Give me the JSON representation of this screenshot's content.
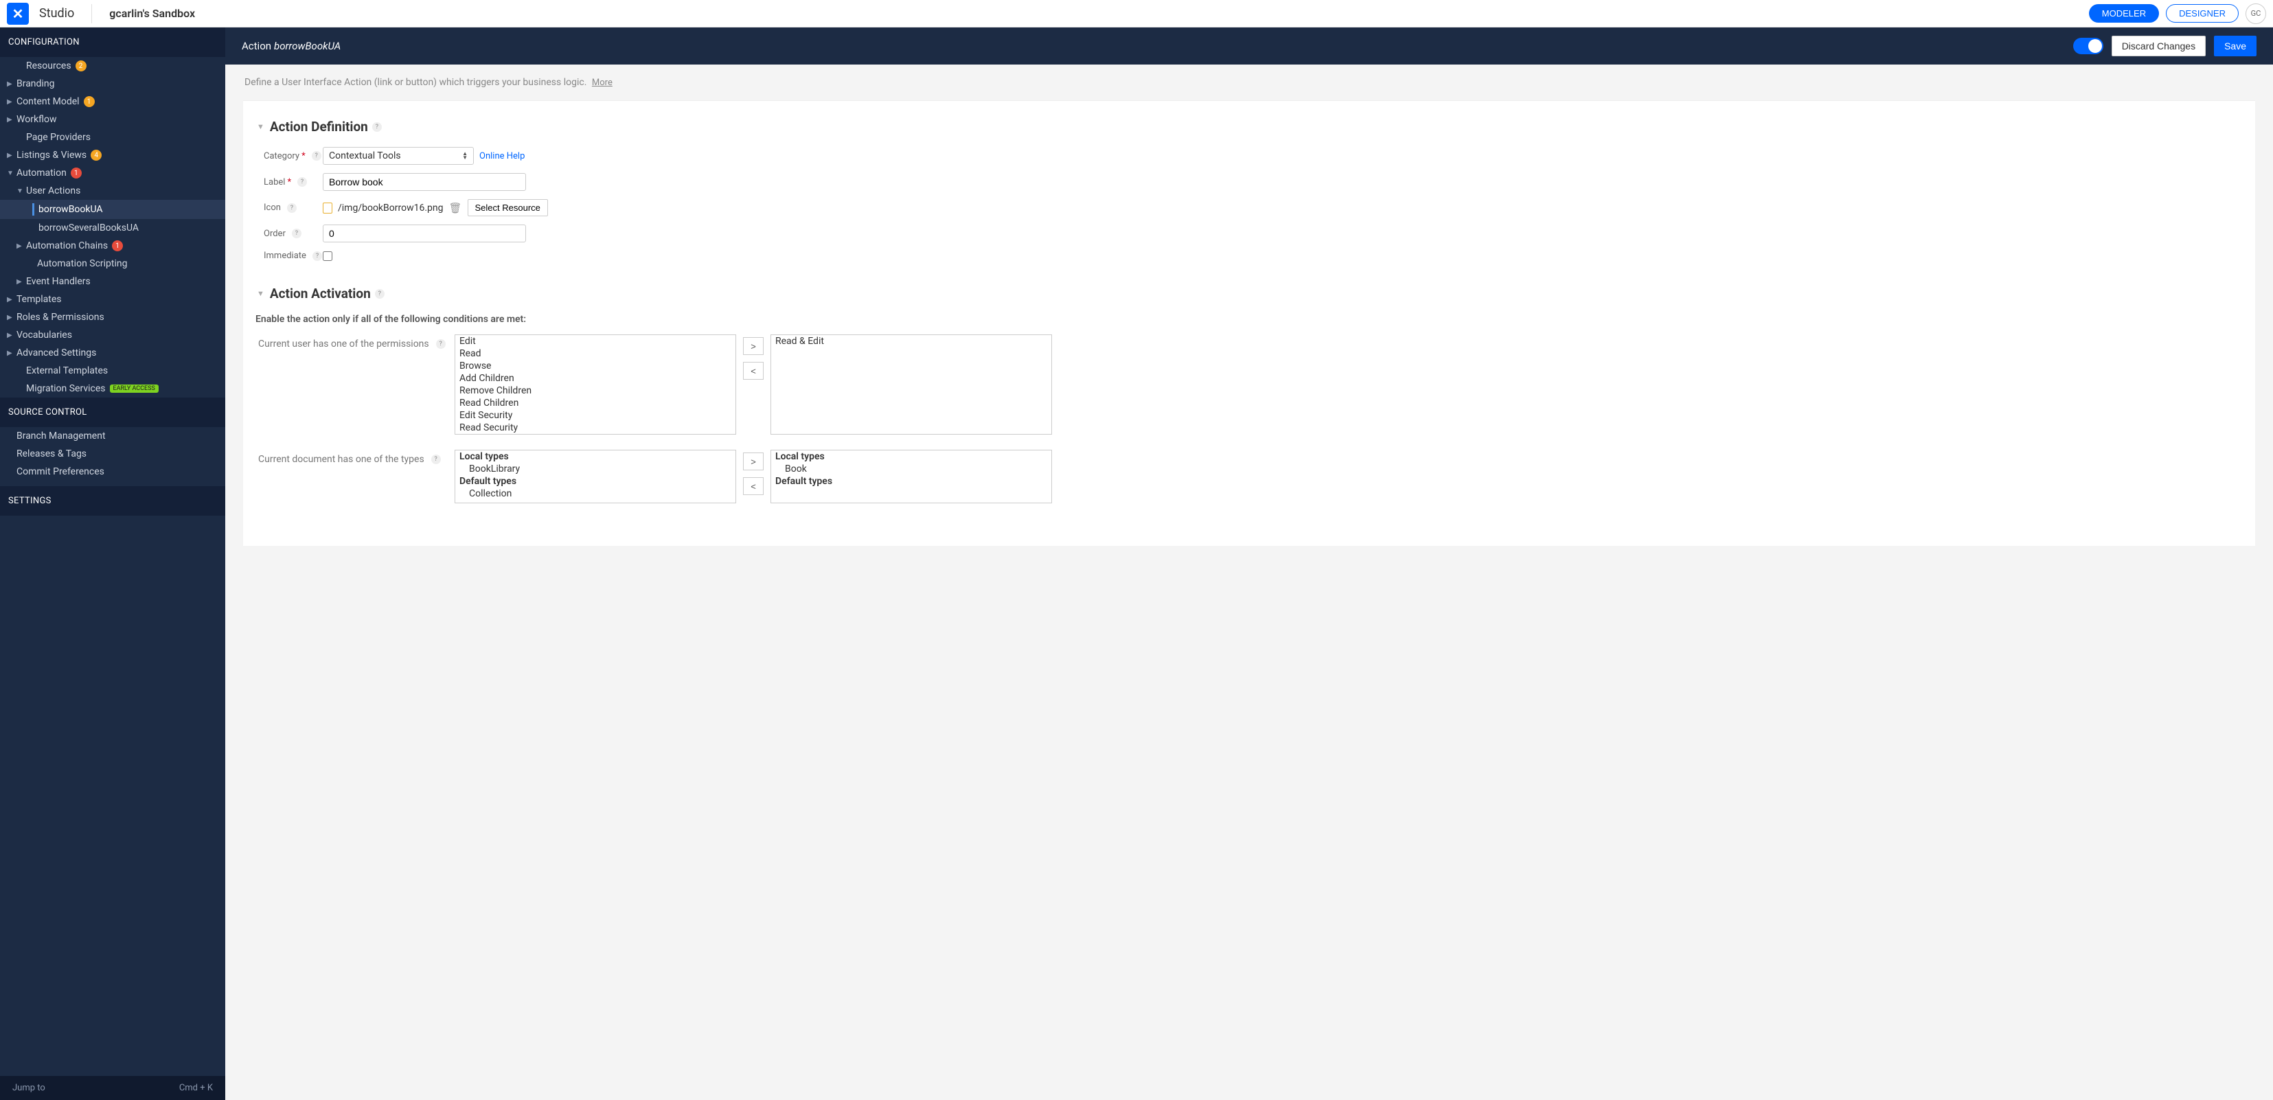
{
  "app": {
    "title": "Studio",
    "project": "gcarlin's Sandbox"
  },
  "header_buttons": {
    "modeler": "MODELER",
    "designer": "DESIGNER",
    "user_initials": "GC"
  },
  "action_bar": {
    "prefix": "Action",
    "name": "borrowBookUA",
    "discard": "Discard Changes",
    "save": "Save"
  },
  "description": {
    "text": "Define a User Interface Action (link or button) which triggers your business logic.",
    "more": "More"
  },
  "sidebar": {
    "sections": {
      "configuration": "CONFIGURATION",
      "source_control": "SOURCE CONTROL",
      "settings": "SETTINGS"
    },
    "items": {
      "resources": "Resources",
      "resources_badge": "2",
      "branding": "Branding",
      "content_model": "Content Model",
      "content_model_badge": "1",
      "workflow": "Workflow",
      "page_providers": "Page Providers",
      "listings": "Listings & Views",
      "listings_badge": "4",
      "automation": "Automation",
      "automation_badge": "1",
      "user_actions": "User Actions",
      "borrowBookUA": "borrowBookUA",
      "borrowSeveralBooksUA": "borrowSeveralBooksUA",
      "automation_chains": "Automation Chains",
      "automation_chains_badge": "1",
      "automation_scripting": "Automation Scripting",
      "event_handlers": "Event Handlers",
      "templates": "Templates",
      "roles": "Roles & Permissions",
      "vocabularies": "Vocabularies",
      "advanced": "Advanced Settings",
      "external_templates": "External Templates",
      "migration": "Migration Services",
      "migration_badge": "EARLY ACCESS",
      "branch_mgmt": "Branch Management",
      "releases": "Releases & Tags",
      "commit_prefs": "Commit Preferences"
    },
    "footer": {
      "jump": "Jump to",
      "shortcut": "Cmd + K"
    }
  },
  "action_definition": {
    "title": "Action Definition",
    "category_label": "Category",
    "category_value": "Contextual Tools",
    "online_help": "Online Help",
    "label_label": "Label",
    "label_value": "Borrow book",
    "icon_label": "Icon",
    "icon_value": "/img/bookBorrow16.png",
    "select_resource": "Select Resource",
    "order_label": "Order",
    "order_value": "0",
    "immediate_label": "Immediate"
  },
  "action_activation": {
    "title": "Action Activation",
    "subheading": "Enable the action only if all of the following conditions are met:",
    "permissions_label": "Current user has one of the permissions",
    "permissions_available": [
      "Edit",
      "Read",
      "Browse",
      "Add Children",
      "Remove Children",
      "Read Children",
      "Edit Security",
      "Read Security"
    ],
    "permissions_selected": [
      "Read & Edit"
    ],
    "types_label": "Current document has one of the types",
    "types_available": [
      {
        "group": "Local types",
        "items": [
          "BookLibrary"
        ]
      },
      {
        "group": "Default types",
        "items": [
          "Collection"
        ]
      }
    ],
    "types_selected": [
      {
        "group": "Local types",
        "items": [
          "Book"
        ]
      },
      {
        "group": "Default types",
        "items": []
      }
    ]
  }
}
